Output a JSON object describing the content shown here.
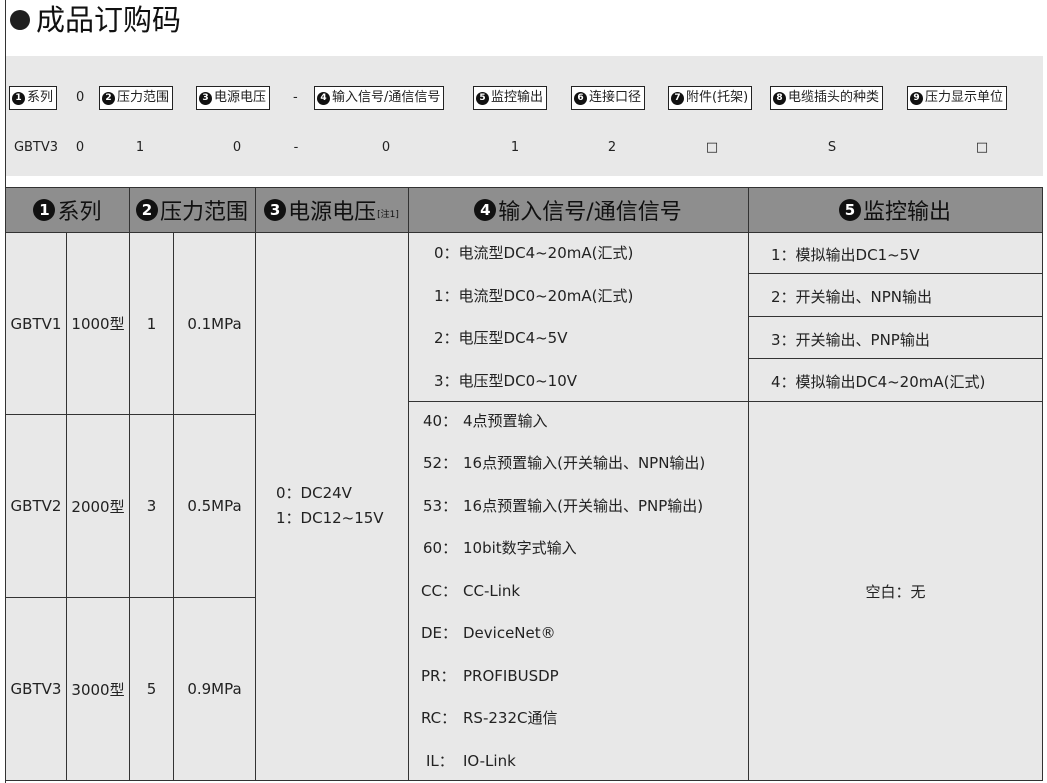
{
  "title": "成品订购码",
  "code_labels": [
    {
      "num": "1",
      "text": "系列"
    },
    {
      "num": "2",
      "text": "压力范围"
    },
    {
      "num": "3",
      "text": "电源电压"
    },
    {
      "num": "4",
      "text": "输入信号/通信信号"
    },
    {
      "num": "5",
      "text": "监控输出"
    },
    {
      "num": "6",
      "text": "连接口径"
    },
    {
      "num": "7",
      "text": "附件(托架)"
    },
    {
      "num": "8",
      "text": "电缆插头的种类"
    },
    {
      "num": "9",
      "text": "压力显示单位"
    }
  ],
  "code_sep_zero": "0",
  "code_sep_dash": "-",
  "code_values": {
    "series": "GBTV3",
    "zero": "0",
    "pressure": "1",
    "voltage": "0",
    "dash": "-",
    "input": "0",
    "monitor": "1",
    "port": "2",
    "accessory": "□",
    "cable": "S",
    "unit": "□"
  },
  "table": {
    "headers": [
      {
        "num": "1",
        "text": "系列"
      },
      {
        "num": "2",
        "text": "压力范围"
      },
      {
        "num": "3",
        "text": "电源电压",
        "note": "[注1]"
      },
      {
        "num": "4",
        "text": "输入信号/通信信号"
      },
      {
        "num": "5",
        "text": "监控输出"
      }
    ],
    "series_rows": [
      {
        "code": "GBTV1",
        "model": "1000型",
        "range_code": "1",
        "range": "0.1MPa"
      },
      {
        "code": "GBTV2",
        "model": "2000型",
        "range_code": "3",
        "range": "0.5MPa"
      },
      {
        "code": "GBTV3",
        "model": "3000型",
        "range_code": "5",
        "range": "0.9MPa"
      }
    ],
    "voltage": [
      "0：DC24V",
      "1：DC12~15V"
    ],
    "input_analog": [
      "0：电流型DC4~20mA(汇式)",
      "1：电流型DC0~20mA(汇式)",
      "2：电压型DC4~5V",
      "3：电压型DC0~10V"
    ],
    "input_other": [
      {
        "code": "40：",
        "text": "4点预置输入"
      },
      {
        "code": "52：",
        "text": "16点预置输入(开关输出、NPN输出)"
      },
      {
        "code": "53：",
        "text": "16点预置输入(开关输出、PNP输出)"
      },
      {
        "code": "60：",
        "text": "10bit数字式输入"
      },
      {
        "code": "CC：",
        "text": "CC-Link"
      },
      {
        "code": "DE：",
        "text": "DeviceNet®"
      },
      {
        "code": "PR：",
        "text": "PROFIBUSDP"
      },
      {
        "code": "RC：",
        "text": "RS-232C通信"
      },
      {
        "code": "IL：",
        "text": "IO-Link"
      }
    ],
    "monitor": [
      "1：模拟输出DC1~5V",
      "2：开关输出、NPN输出",
      "3：开关输出、PNP输出",
      "4：模拟输出DC4~20mA(汇式)"
    ],
    "monitor_blank": "空白：无"
  }
}
